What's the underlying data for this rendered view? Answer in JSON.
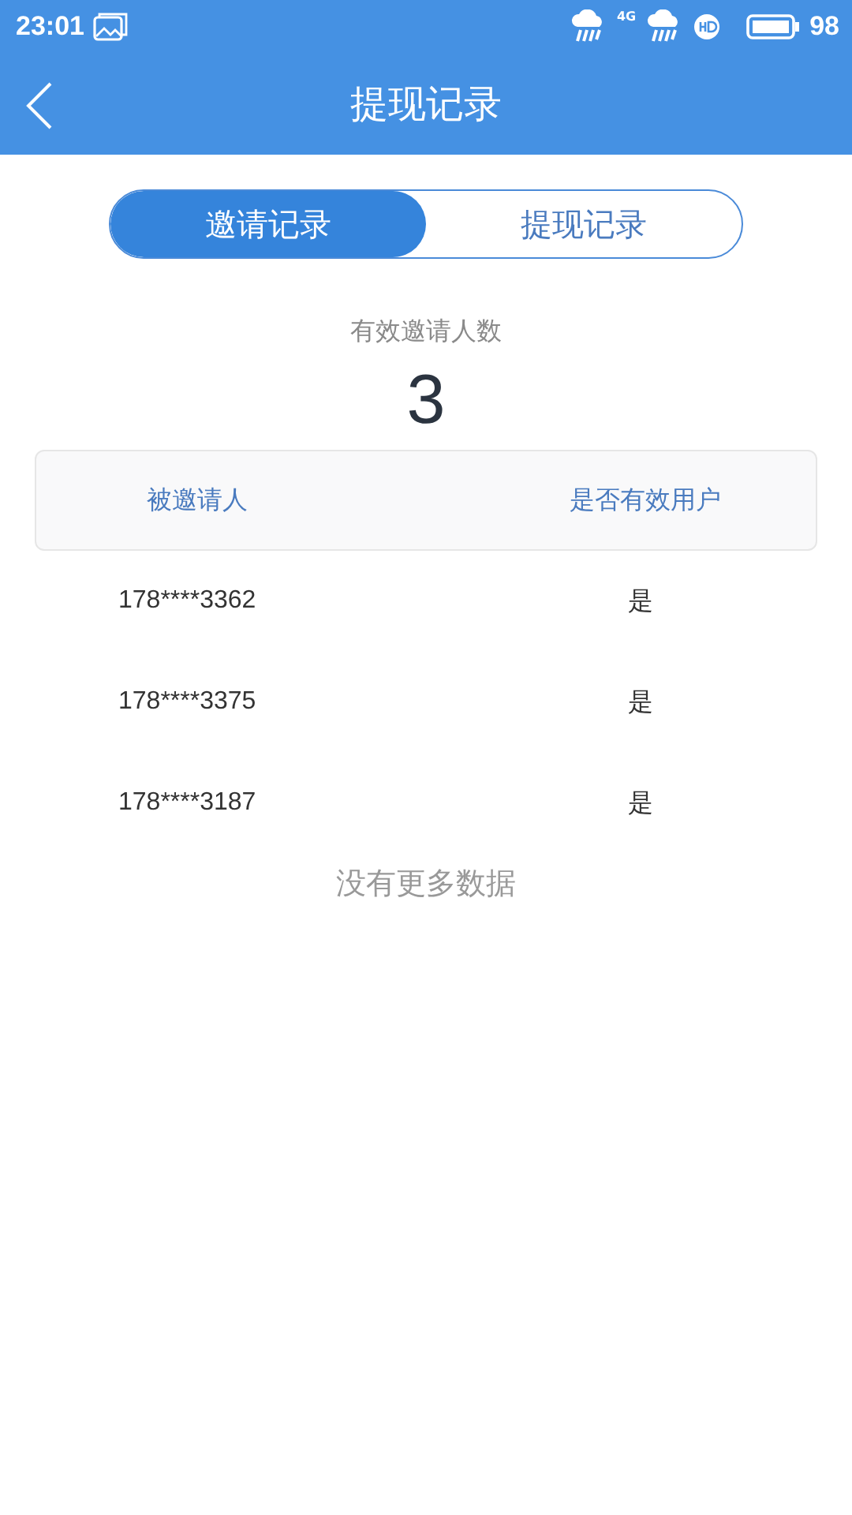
{
  "status_bar": {
    "time": "23:01",
    "network": "4G",
    "battery": "98"
  },
  "header": {
    "title": "提现记录"
  },
  "tabs": [
    {
      "label": "邀请记录",
      "selected": true
    },
    {
      "label": "提现记录",
      "selected": false
    }
  ],
  "summary": {
    "label": "有效邀请人数",
    "value": "3"
  },
  "table": {
    "columns": [
      "被邀请人",
      "是否有效用户"
    ],
    "rows": [
      [
        "178****3362",
        "是"
      ],
      [
        "178****3375",
        "是"
      ],
      [
        "178****3187",
        "是"
      ]
    ]
  },
  "footer_note": "没有更多数据"
}
